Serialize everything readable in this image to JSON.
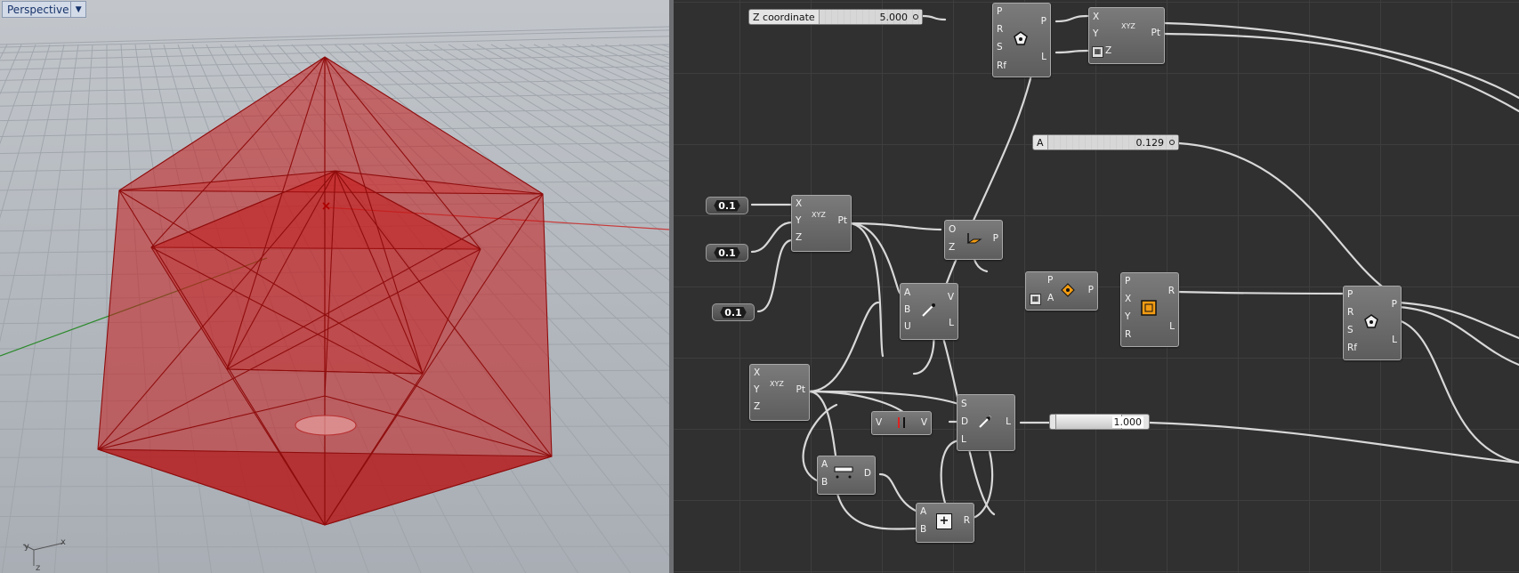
{
  "viewport": {
    "name": "Perspective",
    "axis_labels": {
      "x": "x",
      "y": "y",
      "z": "z"
    }
  },
  "colors": {
    "shape_fill": "#c41a1a",
    "shape_edge": "#8f0c0c",
    "canvas_bg": "#303030",
    "wire": "#d8d8d8"
  },
  "sliders": {
    "z_coordinate": {
      "name": "Z coordinate",
      "value": "5.000"
    },
    "a": {
      "name": "A",
      "value": "0.129"
    },
    "unnamed": {
      "value": "1.000"
    }
  },
  "number_panels": [
    "0.1",
    "0.1",
    "0.1"
  ],
  "components": {
    "polygon_top": {
      "inputs": [
        "P",
        "R",
        "S",
        "Rf"
      ],
      "outputs": [
        "P",
        "L"
      ],
      "icon": "polygon-icon"
    },
    "construct_point_top": {
      "inputs": [
        "X",
        "Y",
        "Z"
      ],
      "outputs": [
        "Pt"
      ],
      "icon": "xyz-icon",
      "icon_text": "XYZ"
    },
    "construct_point_mid": {
      "inputs": [
        "X",
        "Y",
        "Z"
      ],
      "outputs": [
        "Pt"
      ],
      "icon": "xyz-icon",
      "icon_text": "XYZ"
    },
    "construct_point_low": {
      "inputs": [
        "X",
        "Y",
        "Z"
      ],
      "outputs": [
        "Pt"
      ],
      "icon": "xyz-icon",
      "icon_text": "XYZ"
    },
    "xy_plane": {
      "inputs": [
        "O",
        "Z"
      ],
      "outputs": [
        "P"
      ],
      "icon": "plane-icon"
    },
    "line_abu": {
      "inputs": [
        "A",
        "B",
        "U"
      ],
      "outputs": [
        "V",
        "L"
      ],
      "icon": "line-icon"
    },
    "rotate_plane": {
      "inputs": [
        "P",
        "A"
      ],
      "outputs": [
        "P"
      ],
      "icon": "rotate-icon"
    },
    "rectangle": {
      "inputs": [
        "P",
        "X",
        "Y",
        "R"
      ],
      "outputs": [
        "R",
        "L"
      ],
      "icon": "rectangle-icon"
    },
    "polygon_right": {
      "inputs": [
        "P",
        "R",
        "S",
        "Rf"
      ],
      "outputs": [
        "P",
        "L"
      ],
      "icon": "polygon-icon"
    },
    "reverse": {
      "inputs": [
        "V"
      ],
      "outputs": [
        "V"
      ],
      "icon": "reverse-icon"
    },
    "line_sdl": {
      "inputs": [
        "S",
        "D",
        "L"
      ],
      "outputs": [
        "L"
      ],
      "icon": "line-sdl-icon"
    },
    "distance": {
      "inputs": [
        "A",
        "B"
      ],
      "outputs": [
        "D"
      ],
      "icon": "distance-icon"
    },
    "addition": {
      "inputs": [
        "A",
        "B"
      ],
      "outputs": [
        "R"
      ],
      "icon": "plus-icon",
      "icon_text": "+"
    }
  }
}
